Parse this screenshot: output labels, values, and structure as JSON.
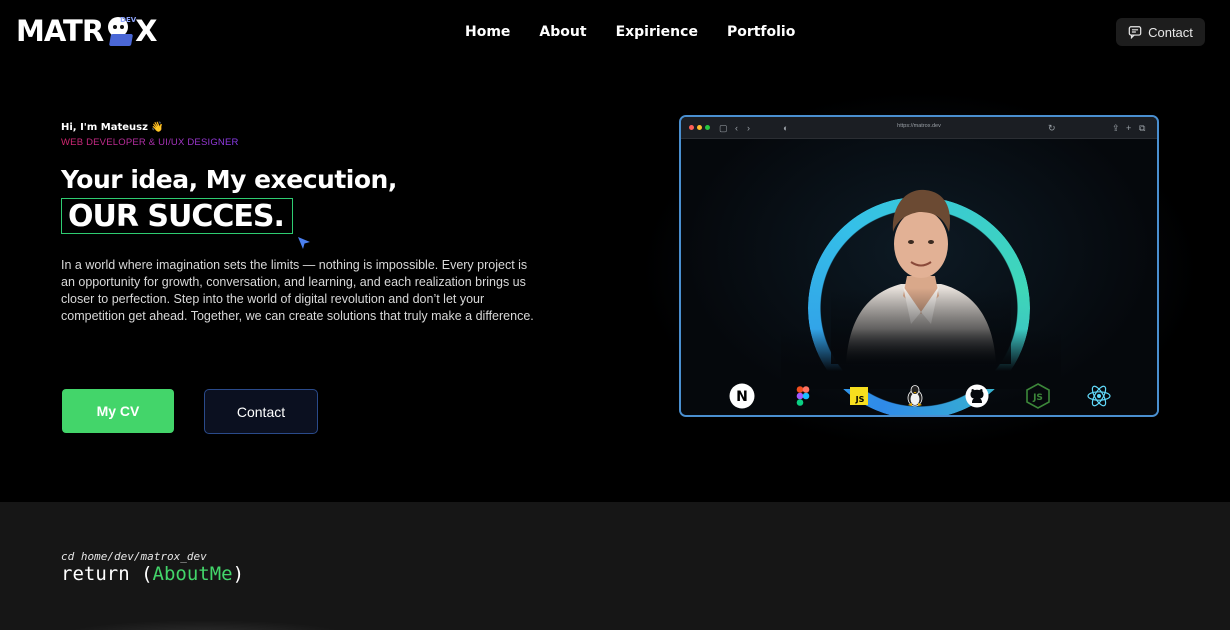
{
  "header": {
    "logo_text_left": "MATR",
    "logo_text_right": "X",
    "logo_badge": "DEV",
    "nav": [
      {
        "label": "Home"
      },
      {
        "label": "About"
      },
      {
        "label": "Expirience"
      },
      {
        "label": "Portfolio"
      }
    ],
    "contact_label": "Contact"
  },
  "hero": {
    "greeting": "Hi, I'm Mateusz 👋",
    "role": "WEB DEVELOPER & UI/UX DESIGNER",
    "headline": "Your idea, My execution,",
    "highlight": "OUR SUCCES.",
    "description": "In a world where imagination sets the limits — nothing is impossible. Every project is an opportunity for growth, conversation, and learning, and each realization brings us closer to perfection. Step into the world of digital revolution and don’t let your competition get ahead. Together, we can create solutions that truly make a difference.",
    "cv_button": "My CV",
    "contact_button": "Contact"
  },
  "browser": {
    "url": "https://matrox.dev",
    "tech_icons": [
      "nextjs-icon",
      "figma-icon",
      "javascript-icon",
      "linux-icon",
      "github-icon",
      "nodejs-icon",
      "react-icon"
    ]
  },
  "about": {
    "command": "cd home/dev/matrox_dev",
    "return_prefix": "return (",
    "return_name": "AboutMe",
    "return_suffix": ")"
  },
  "colors": {
    "accent_green": "#43d56a",
    "accent_blue": "#4a8fd0",
    "role_gradient_start": "#d6266e",
    "role_gradient_end": "#8b3cf0"
  }
}
